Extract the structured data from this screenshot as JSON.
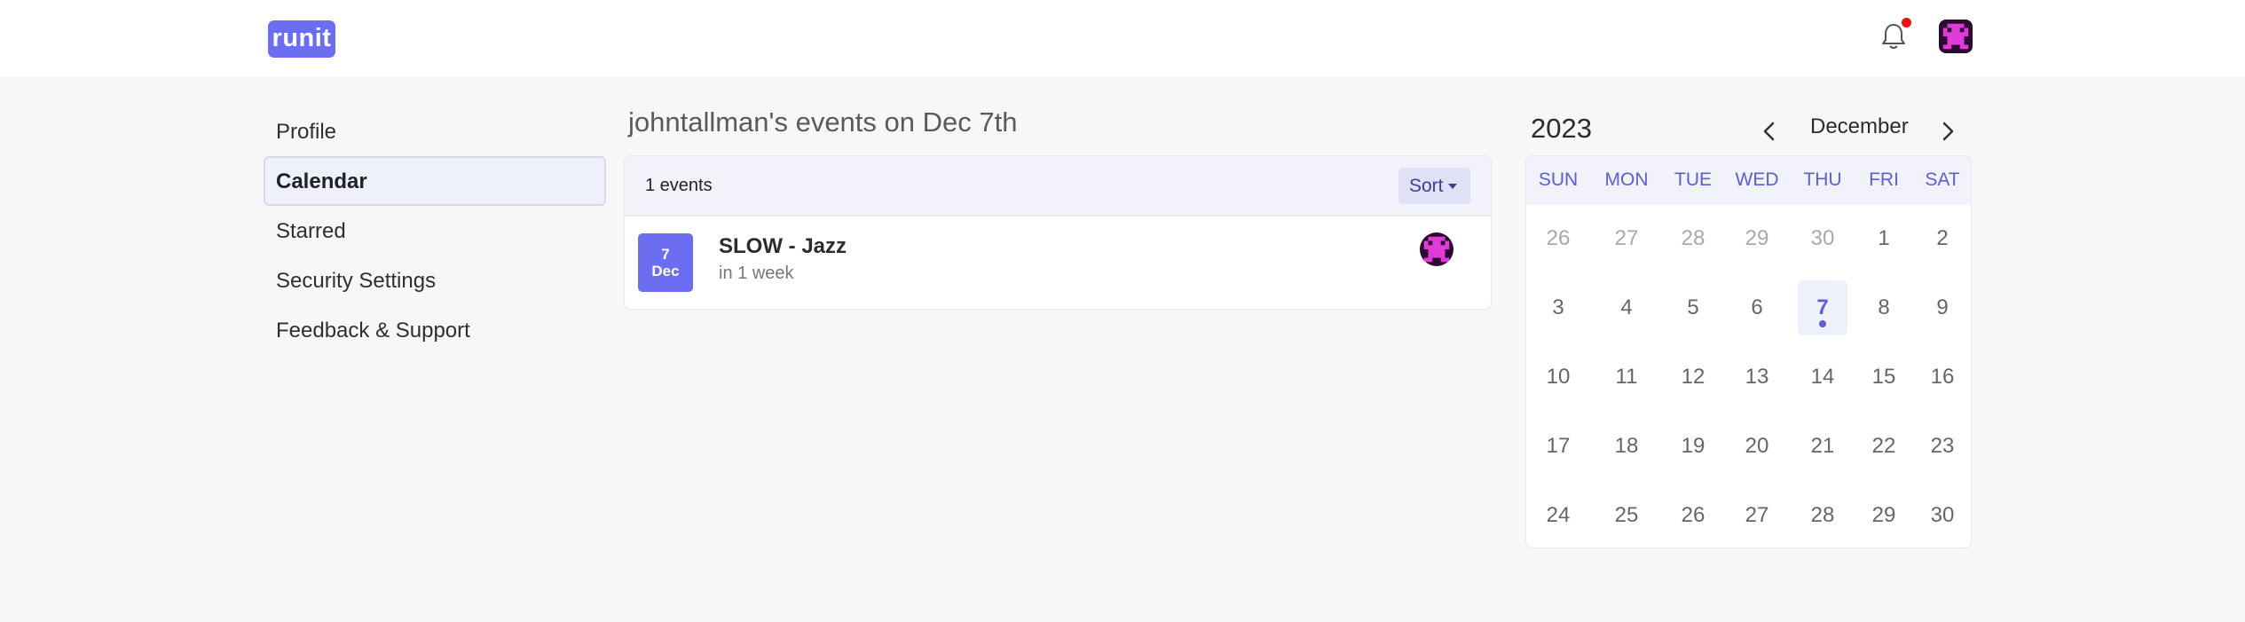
{
  "header": {
    "logo_text": "runit",
    "has_notification": true
  },
  "sidebar": {
    "items": [
      {
        "label": "Profile"
      },
      {
        "label": "Calendar"
      },
      {
        "label": "Starred"
      },
      {
        "label": "Security Settings"
      },
      {
        "label": "Feedback & Support"
      }
    ]
  },
  "events": {
    "title": "johntallman's events on Dec 7th",
    "count_label": "1 events",
    "sort_label": "Sort",
    "items": [
      {
        "day": "7",
        "month": "Dec",
        "name": "SLOW - Jazz",
        "relative": "in 1 week"
      }
    ]
  },
  "calendar": {
    "year": "2023",
    "month": "December",
    "weekdays": [
      "SUN",
      "MON",
      "TUE",
      "WED",
      "THU",
      "FRI",
      "SAT"
    ],
    "weeks": [
      [
        "26",
        "27",
        "28",
        "29",
        "30",
        "1",
        "2"
      ],
      [
        "3",
        "4",
        "5",
        "6",
        "7",
        "8",
        "9"
      ],
      [
        "10",
        "11",
        "12",
        "13",
        "14",
        "15",
        "16"
      ],
      [
        "17",
        "18",
        "19",
        "20",
        "21",
        "22",
        "23"
      ],
      [
        "24",
        "25",
        "26",
        "27",
        "28",
        "29",
        "30"
      ]
    ],
    "selected_day": "7"
  },
  "colors": {
    "accent": "#6b6ef0",
    "accent_text": "#5b5ed6",
    "notification": "#ee1111",
    "avatar_bg": "#2a0a2e",
    "avatar_fg": "#e03ad8"
  }
}
